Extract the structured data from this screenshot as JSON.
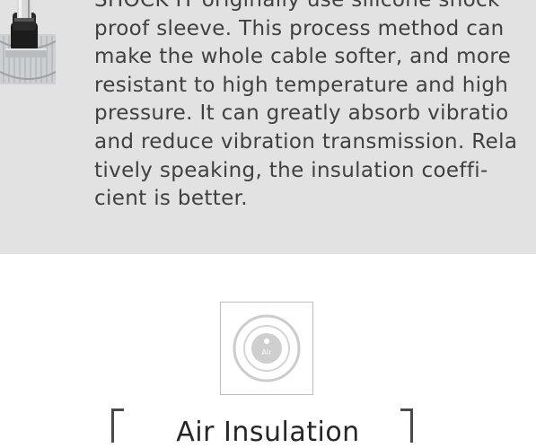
{
  "description": {
    "lines": [
      "SHOCK IT originally use silicone shock",
      "proof sleeve. This process method can",
      "make the whole cable softer, and more",
      "resistant to high temperature and high",
      "pressure. It can greatly absorb vibratio",
      "and reduce vibration transmission. Rela",
      "tively speaking, the insulation coeffi-",
      "cient is better."
    ]
  },
  "feature": {
    "icon": "air-insulation-icon",
    "icon_text": "Air",
    "title": "Air Insulation"
  },
  "colors": {
    "panel": "#e2e2e2",
    "text": "#404040",
    "icon": "#cfcfcf"
  }
}
